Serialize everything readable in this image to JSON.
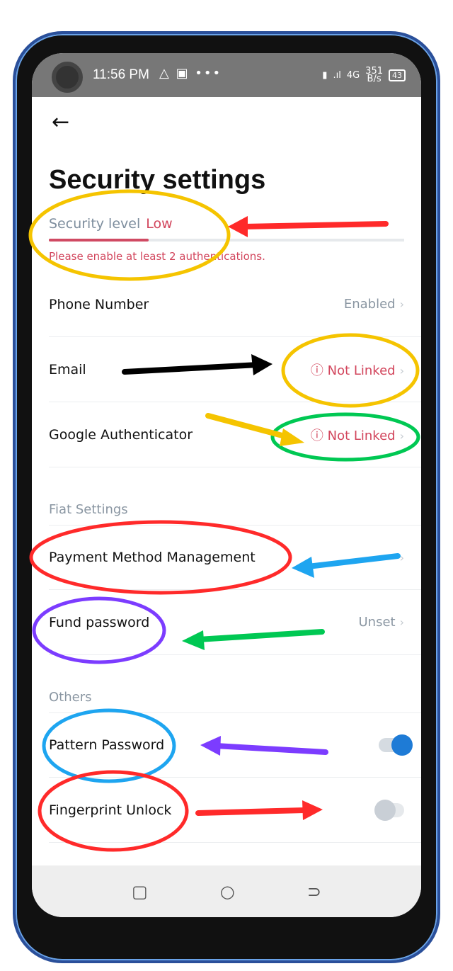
{
  "status_bar": {
    "time": "11:56 PM",
    "network": "4G",
    "speed": "351",
    "speed_unit": "B/s",
    "battery": "43"
  },
  "header": {
    "title": "Security settings"
  },
  "security_level": {
    "label": "Security level",
    "value": "Low",
    "progress": 0.28,
    "warning": "Please enable at least 2 authentications."
  },
  "rows": [
    {
      "label": "Phone Number",
      "value": "Enabled"
    },
    {
      "label": "Email",
      "value": "Not Linked"
    },
    {
      "label": "Google Authenticator",
      "value": "Not Linked"
    }
  ],
  "fiat": {
    "title": "Fiat Settings",
    "rows": [
      {
        "label": "Payment Method Management",
        "value": ""
      },
      {
        "label": "Fund password",
        "value": "Unset"
      }
    ]
  },
  "others": {
    "title": "Others",
    "rows": [
      {
        "label": "Pattern Password",
        "on": true
      },
      {
        "label": "Fingerprint Unlock",
        "on": false
      }
    ]
  },
  "colors": {
    "accent": "#1e7bd6",
    "danger": "#d2455c"
  }
}
